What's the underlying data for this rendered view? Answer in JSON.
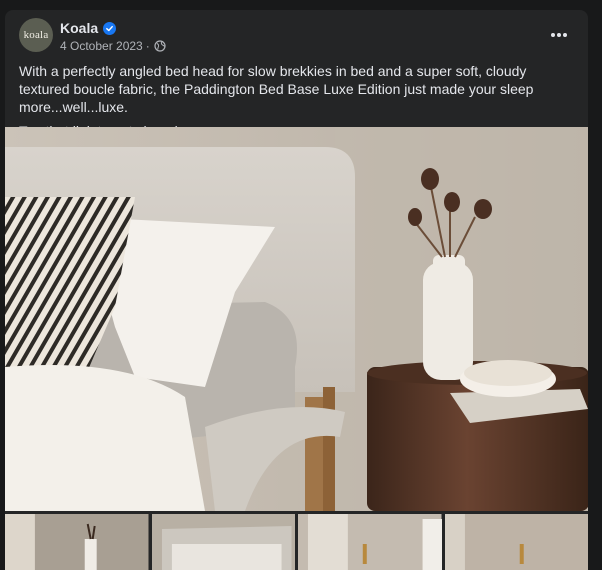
{
  "post": {
    "avatar_text": "koala",
    "page_name": "Koala",
    "date": "4 October 2023",
    "meta_separator": "·",
    "body": "With a perfectly angled bed head for slow brekkies in bed and a super soft, cloudy textured boucle fabric, the Paddington Bed Base Luxe Edition just made your sleep more...well...luxe.",
    "cta": "Tap that link to get shopping."
  },
  "icons": {
    "verified": "verified-badge-icon",
    "audience": "globe-icon",
    "more": "more-options-icon"
  },
  "colors": {
    "background": "#18191a",
    "card": "#242526",
    "text_primary": "#e4e6eb",
    "text_secondary": "#b0b3b8",
    "verified_blue": "#1877f2"
  }
}
